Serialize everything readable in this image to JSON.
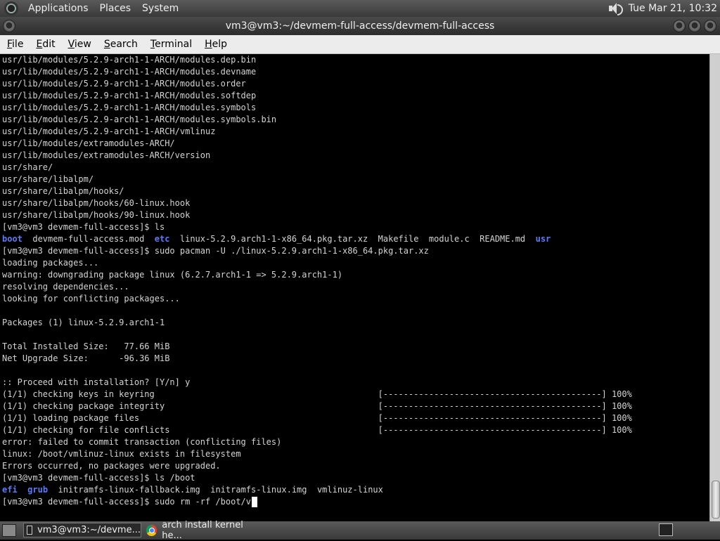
{
  "top_panel": {
    "menus": [
      "Applications",
      "Places",
      "System"
    ],
    "clock": "Tue Mar 21, 10:32"
  },
  "window": {
    "title": "vm3@vm3:~/devmem-full-access/devmem-full-access"
  },
  "menubar": {
    "items": [
      {
        "first": "F",
        "rest": "ile"
      },
      {
        "first": "E",
        "rest": "dit"
      },
      {
        "first": "V",
        "rest": "iew"
      },
      {
        "first": "S",
        "rest": "earch"
      },
      {
        "first": "T",
        "rest": "erminal"
      },
      {
        "first": "H",
        "rest": "elp"
      }
    ]
  },
  "terminal": {
    "lines": [
      "usr/lib/modules/5.2.9-arch1-1-ARCH/modules.dep.bin",
      "usr/lib/modules/5.2.9-arch1-1-ARCH/modules.devname",
      "usr/lib/modules/5.2.9-arch1-1-ARCH/modules.order",
      "usr/lib/modules/5.2.9-arch1-1-ARCH/modules.softdep",
      "usr/lib/modules/5.2.9-arch1-1-ARCH/modules.symbols",
      "usr/lib/modules/5.2.9-arch1-1-ARCH/modules.symbols.bin",
      "usr/lib/modules/5.2.9-arch1-1-ARCH/vmlinuz",
      "usr/lib/modules/extramodules-ARCH/",
      "usr/lib/modules/extramodules-ARCH/version",
      "usr/share/",
      "usr/share/libalpm/",
      "usr/share/libalpm/hooks/",
      "usr/share/libalpm/hooks/60-linux.hook",
      "usr/share/libalpm/hooks/90-linux.hook",
      "[vm3@vm3 devmem-full-access]$ ls",
      [
        {
          "t": "boot",
          "c": "dir"
        },
        {
          "t": "  devmem-full-access.mod  "
        },
        {
          "t": "etc",
          "c": "dir"
        },
        {
          "t": "  linux-5.2.9.arch1-1-x86_64.pkg.tar.xz  Makefile  module.c  README.md  "
        },
        {
          "t": "usr",
          "c": "dir"
        }
      ],
      "[vm3@vm3 devmem-full-access]$ sudo pacman -U ./linux-5.2.9.arch1-1-x86_64.pkg.tar.xz",
      "loading packages...",
      "warning: downgrading package linux (6.2.7.arch1-1 => 5.2.9.arch1-1)",
      "resolving dependencies...",
      "looking for conflicting packages...",
      "",
      "Packages (1) linux-5.2.9.arch1-1",
      "",
      "Total Installed Size:   77.66 MiB",
      "Net Upgrade Size:      -96.36 MiB",
      "",
      ":: Proceed with installation? [Y/n] y",
      "(1/1) checking keys in keyring                                            [-------------------------------------------] 100%",
      "(1/1) checking package integrity                                          [-------------------------------------------] 100%",
      "(1/1) loading package files                                               [-------------------------------------------] 100%",
      "(1/1) checking for file conflicts                                         [-------------------------------------------] 100%",
      "error: failed to commit transaction (conflicting files)",
      "linux: /boot/vmlinuz-linux exists in filesystem",
      "Errors occurred, no packages were upgraded.",
      "[vm3@vm3 devmem-full-access]$ ls /boot",
      [
        {
          "t": "efi",
          "c": "dir"
        },
        {
          "t": "  "
        },
        {
          "t": "grub",
          "c": "dir"
        },
        {
          "t": "  initramfs-linux-fallback.img  initramfs-linux.img  vmlinuz-linux"
        }
      ],
      "[vm3@vm3 devmem-full-access]$ sudo rm -rf /boot/v"
    ]
  },
  "taskbar": {
    "tasks": [
      {
        "label": "vm3@vm3:~/devme...",
        "icon": "terminal-icon"
      },
      {
        "label": "arch install kernel he...",
        "icon": "chrome-icon"
      }
    ]
  }
}
